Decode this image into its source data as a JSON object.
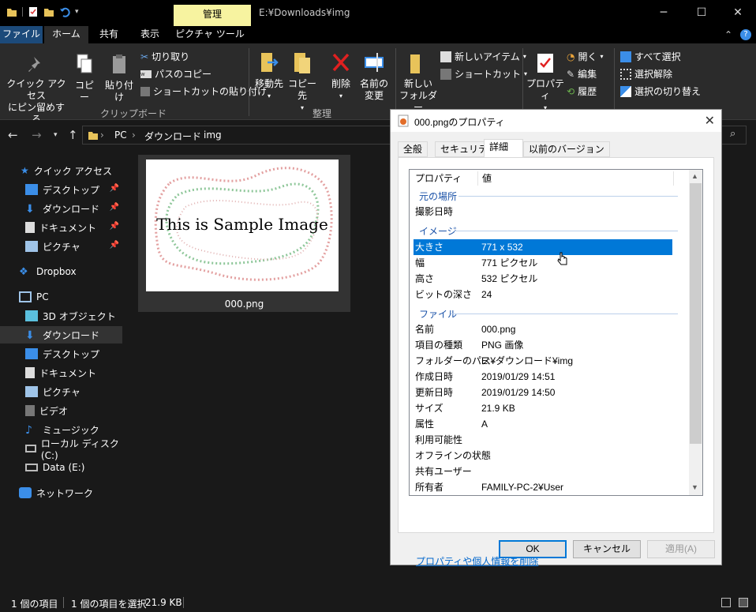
{
  "window": {
    "manage_tab": "管理",
    "title_path": "E:¥Downloads¥img",
    "minimize": "─",
    "maximize": "☐",
    "close": "✕"
  },
  "ribbon_tabs": [
    "ファイル",
    "ホーム",
    "共有",
    "表示",
    "ピクチャ ツール"
  ],
  "ribbon": {
    "pin_quick_access": [
      "クイック アクセス",
      "にピン留めする"
    ],
    "copy": "コピー",
    "paste": "貼り付け",
    "cut": "切り取り",
    "copy_path": "パスのコピー",
    "paste_shortcut": "ショートカットの貼り付け",
    "clipboard_group": "クリップボード",
    "move_to": "移動先",
    "copy_to": "コピー先",
    "delete": "削除",
    "rename": [
      "名前の",
      "変更"
    ],
    "organize_group": "整理",
    "new_folder": [
      "新しい",
      "フォルダー"
    ],
    "new_item": "新しいアイテム",
    "shortcut": "ショートカット",
    "properties": "プロパティ",
    "open": "開く",
    "edit": "編集",
    "history": "履歴",
    "select_all": "すべて選択",
    "select_none": "選択解除",
    "invert_selection": "選択の切り替え"
  },
  "address": {
    "crumbs": [
      "PC",
      "ダウンロード",
      "img"
    ]
  },
  "nav": {
    "items": [
      {
        "label": "クイック アクセス",
        "icon": "star-icon"
      },
      {
        "label": "デスクトップ",
        "icon": "desktop-icon"
      },
      {
        "label": "ダウンロード",
        "icon": "download-icon"
      },
      {
        "label": "ドキュメント",
        "icon": "document-icon"
      },
      {
        "label": "ピクチャ",
        "icon": "pictures-icon"
      },
      {
        "label": "Dropbox",
        "icon": "dropbox-icon"
      },
      {
        "label": "PC",
        "icon": "pc-icon"
      },
      {
        "label": "3D オブジェクト",
        "icon": "cube-icon"
      },
      {
        "label": "ダウンロード",
        "icon": "download-icon"
      },
      {
        "label": "デスクトップ",
        "icon": "desktop-icon"
      },
      {
        "label": "ドキュメント",
        "icon": "document-icon"
      },
      {
        "label": "ピクチャ",
        "icon": "pictures-icon"
      },
      {
        "label": "ビデオ",
        "icon": "video-icon"
      },
      {
        "label": "ミュージック",
        "icon": "music-icon"
      },
      {
        "label": "ローカル ディスク (C:)",
        "icon": "drive-icon"
      },
      {
        "label": "Data (E:)",
        "icon": "drive-icon"
      },
      {
        "label": "ネットワーク",
        "icon": "network-icon"
      }
    ]
  },
  "content": {
    "thumbnail_text": "This is Sample Image",
    "file_name": "000.png"
  },
  "status": {
    "item_count": "1 個の項目",
    "selected": "1 個の項目を選択",
    "size": "21.9 KB"
  },
  "dialog": {
    "title": "000.pngのプロパティ",
    "tabs": [
      "全般",
      "セキュリティ",
      "詳細",
      "以前のバージョン"
    ],
    "active_tab": "詳細",
    "col_property": "プロパティ",
    "col_value": "値",
    "sections": {
      "origin": "元の場所",
      "image": "イメージ",
      "file": "ファイル"
    },
    "rows": {
      "date_taken": {
        "k": "撮影日時",
        "v": ""
      },
      "dimensions": {
        "k": "大きさ",
        "v": "771 x 532"
      },
      "width": {
        "k": "幅",
        "v": "771 ピクセル"
      },
      "height": {
        "k": "高さ",
        "v": "532 ピクセル"
      },
      "bit_depth": {
        "k": "ビットの深さ",
        "v": "24"
      },
      "name": {
        "k": "名前",
        "v": "000.png"
      },
      "item_type": {
        "k": "項目の種類",
        "v": "PNG 画像"
      },
      "folder_path": {
        "k": "フォルダーのパス",
        "v": "E:¥ダウンロード¥img"
      },
      "created": {
        "k": "作成日時",
        "v": "2019/01/29 14:51"
      },
      "modified": {
        "k": "更新日時",
        "v": "2019/01/29 14:50"
      },
      "size": {
        "k": "サイズ",
        "v": "21.9 KB"
      },
      "attributes": {
        "k": "属性",
        "v": "A"
      },
      "availability": {
        "k": "利用可能性",
        "v": ""
      },
      "offline_status": {
        "k": "オフラインの状態",
        "v": ""
      },
      "shared_with": {
        "k": "共有ユーザー",
        "v": ""
      },
      "owner": {
        "k": "所有者",
        "v": "FAMILY-PC-2¥User"
      }
    },
    "remove_link": "プロパティや個人情報を削除",
    "ok": "OK",
    "cancel": "キャンセル",
    "apply": "適用(A)"
  },
  "colors": {
    "accent": "#0078d7",
    "manage_tab": "#f7f3a0",
    "file_tab": "#1c4a7a",
    "background": "#191919"
  }
}
